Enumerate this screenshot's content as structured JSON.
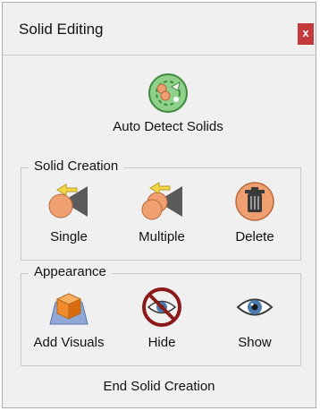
{
  "window": {
    "title": "Solid Editing",
    "close_label": "x"
  },
  "auto_detect": {
    "label": "Auto Detect Solids"
  },
  "solid_creation": {
    "legend": "Solid Creation",
    "tools": [
      "Single",
      "Multiple",
      "Delete"
    ]
  },
  "appearance": {
    "legend": "Appearance",
    "tools": [
      "Add Visuals",
      "Hide",
      "Show"
    ]
  },
  "footer": {
    "end_label": "End Solid Creation"
  },
  "colors": {
    "close_bg": "#c33a3a",
    "panel_bg": "#f0f0f0",
    "accent_green": "#4caf50",
    "orange": "#f0a070"
  }
}
